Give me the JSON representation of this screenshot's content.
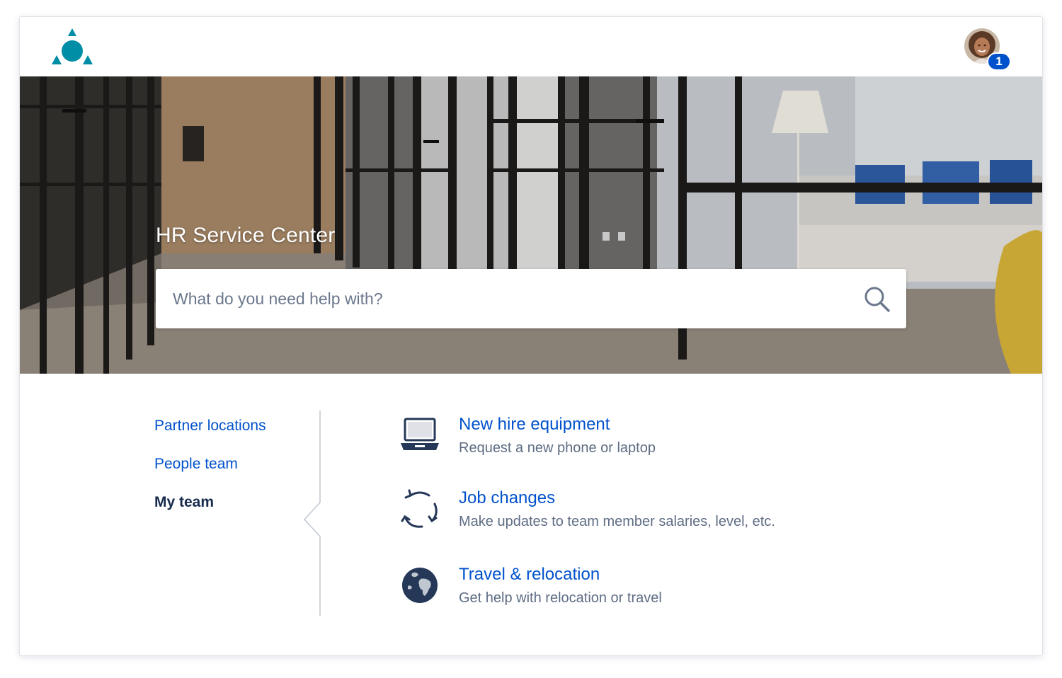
{
  "brand": {
    "logo_icon": "atlassian-like-triangle-logo",
    "accent": "#008da6"
  },
  "user": {
    "notification_count": "1",
    "avatar_icon": "user-avatar"
  },
  "hero": {
    "title": "HR Service Center",
    "search": {
      "value": "",
      "placeholder": "What do you need help with?"
    }
  },
  "nav": {
    "items": [
      {
        "label": "Partner locations"
      },
      {
        "label": "People team"
      },
      {
        "label": "My team"
      }
    ],
    "selected": "My team"
  },
  "request_types": [
    {
      "title": "New hire equipment",
      "description": "Request a new phone or laptop",
      "icon": "laptop-icon"
    },
    {
      "title": "Job changes",
      "description": "Make updates to team member salaries, level, etc.",
      "icon": "refresh-cycle-icon"
    },
    {
      "title": "Travel & relocation",
      "description": "Get help with relocation or travel",
      "icon": "globe-icon"
    }
  ],
  "colors": {
    "link": "#0052cc",
    "text_dark": "#172b4d",
    "text_muted": "#5e6c84",
    "badge": "#0052cc",
    "icon_navy": "#253858"
  }
}
